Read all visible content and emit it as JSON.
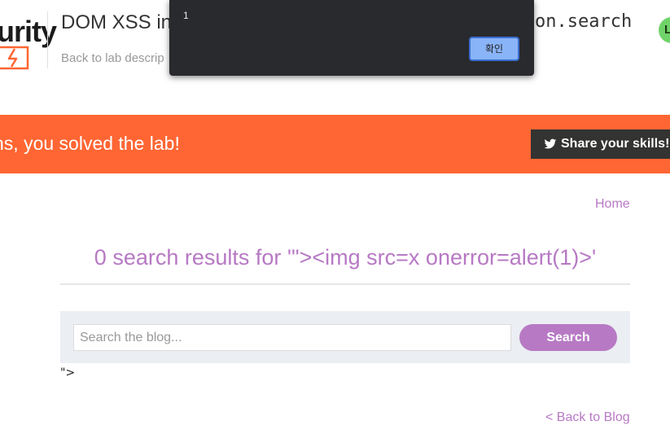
{
  "header": {
    "logo_text": "urity",
    "lab_title": "DOM XSS in",
    "lab_title_end": "on.search",
    "back_to_lab": "Back to lab descrip",
    "avatar_letter": "L"
  },
  "dialog": {
    "message": "1",
    "ok_label": "확인"
  },
  "banner": {
    "message": "ns, you solved the lab!",
    "share_label": "Share your skills!",
    "color": "#ff6633"
  },
  "nav": {
    "home": "Home"
  },
  "main": {
    "results_heading": "0 search results for '\"><img src=x onerror=alert(1)>'",
    "search_placeholder": "Search the blog...",
    "search_button": "Search",
    "reflected_text": "\">",
    "back_to_blog": "< Back to Blog",
    "accent": "#b779c4"
  }
}
